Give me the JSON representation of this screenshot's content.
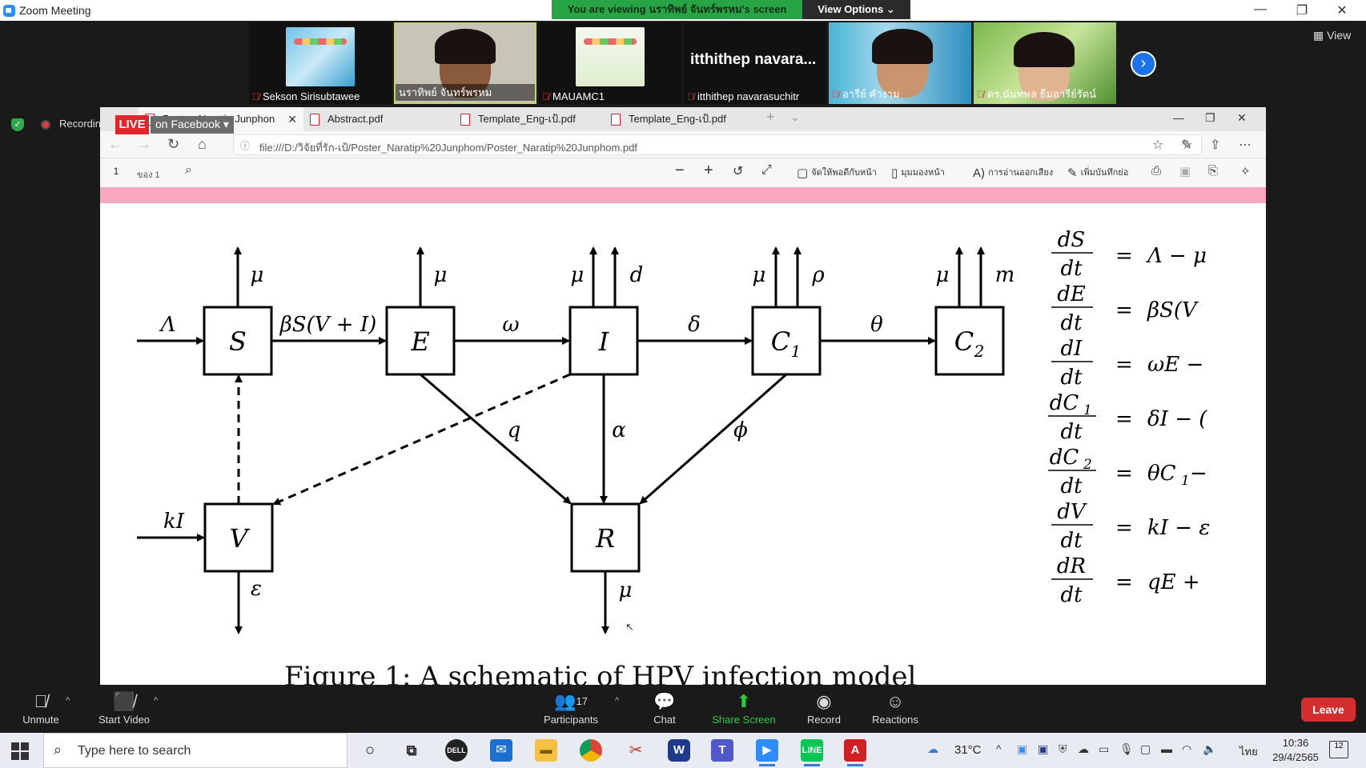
{
  "window": {
    "title": "Zoom Meeting",
    "minimize": "—",
    "restore": "❐",
    "close": "✕"
  },
  "banner": {
    "viewing": "You are viewing นราทิพย์ จันทร์พรหม's screen",
    "view_options": "View Options ⌄"
  },
  "participants_strip": [
    {
      "label": "Sekson Sirisubtawee"
    },
    {
      "label": "นราทิพย์ จันทร์พรหม"
    },
    {
      "label": "MAUAMC1"
    },
    {
      "label": "itthithep navarasuchitr",
      "big_name": "itthithep  navara..."
    },
    {
      "label": "อารีย์ คำงาม"
    },
    {
      "label": "ดร.นันทพล ธีมอารีย์รัตน์"
    }
  ],
  "view_button": "View",
  "recording": {
    "label": "Recording",
    "live": "LIVE",
    "live_target": "on Facebook"
  },
  "browser": {
    "tabs": [
      {
        "label": "Poster_Naratip Junphon"
      },
      {
        "label": "Abstract.pdf"
      },
      {
        "label": "Template_Eng-เป้.pdf"
      },
      {
        "label": "Template_Eng-เป้.pdf"
      }
    ],
    "url": "file:///D:/วิจัยที่รัก-เป้/Poster_Naratip%20Junphom/Poster_Naratip%20Junphom.pdf",
    "page_number": "1",
    "page_of": "ของ 1",
    "tools": {
      "fit": "จัดให้พอดีกับหน้า",
      "page_view": "มุมมองหน้า",
      "read_aloud": "การอ่านออกเสียง",
      "annotate": "เพิ่มบันทึกย่อ"
    }
  },
  "diagram": {
    "compartments": {
      "S": "S",
      "E": "E",
      "I": "I",
      "C1": "C",
      "C1_sub": "1",
      "C2": "C",
      "C2_sub": "2",
      "V": "V",
      "R": "R"
    },
    "rates": {
      "Lambda": "Λ",
      "beta": "βS(V + I)",
      "omega": "ω",
      "delta": "δ",
      "theta": "θ",
      "kI": "kI",
      "q": "q",
      "alpha": "α",
      "phi": "ϕ",
      "epsilon": "ε",
      "mu": "μ",
      "d": "d",
      "rho": "ρ",
      "m": "m"
    }
  },
  "equations": [
    {
      "num": "dS",
      "den": "dt",
      "rhs": "Λ − μ"
    },
    {
      "num": "dE",
      "den": "dt",
      "rhs": "βS(V"
    },
    {
      "num": "dI",
      "den": "dt",
      "rhs": "ωE −"
    },
    {
      "num": "dC",
      "num_sub": "1",
      "den": "dt",
      "rhs": "δI − ("
    },
    {
      "num": "dC",
      "num_sub": "2",
      "den": "dt",
      "rhs": "θC",
      "rhs_sub": "1",
      "rhs_tail": " −"
    },
    {
      "num": "dV",
      "den": "dt",
      "rhs": "kI − ε"
    },
    {
      "num": "dR",
      "den": "dt",
      "rhs": "qE +"
    }
  ],
  "eq_sign": "=",
  "figure_caption": "Figure 1: A schematic of HPV infection model",
  "controls": {
    "unmute": "Unmute",
    "start_video": "Start Video",
    "participants": "Participants",
    "participants_count": "17",
    "chat": "Chat",
    "share_screen": "Share Screen",
    "record": "Record",
    "reactions": "Reactions",
    "leave": "Leave"
  },
  "taskbar": {
    "search_placeholder": "Type here to search",
    "weather": "31°C",
    "language": "ไทย",
    "time": "10:36",
    "date": "29/4/2565",
    "notifications": "12"
  }
}
